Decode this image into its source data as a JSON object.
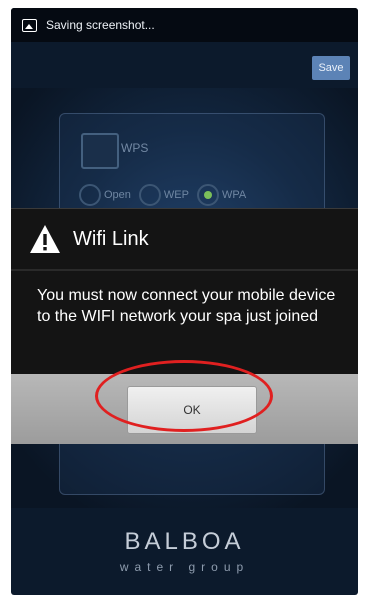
{
  "status_bar": {
    "text": "Saving screenshot..."
  },
  "background": {
    "save_label": "Save",
    "wps_label": "WPS",
    "security_options": [
      {
        "label": "Open",
        "selected": false
      },
      {
        "label": "WEP",
        "selected": false
      },
      {
        "label": "WPA",
        "selected": true
      }
    ]
  },
  "dialog": {
    "title": "Wifi Link",
    "message": "You must now connect your mobile device to the WIFI network your spa just joined",
    "ok_label": "OK"
  },
  "branding": {
    "name": "BALBOA",
    "tagline": "water group"
  },
  "colors": {
    "highlight_ring": "#e02020",
    "dialog_bg": "#141414"
  }
}
